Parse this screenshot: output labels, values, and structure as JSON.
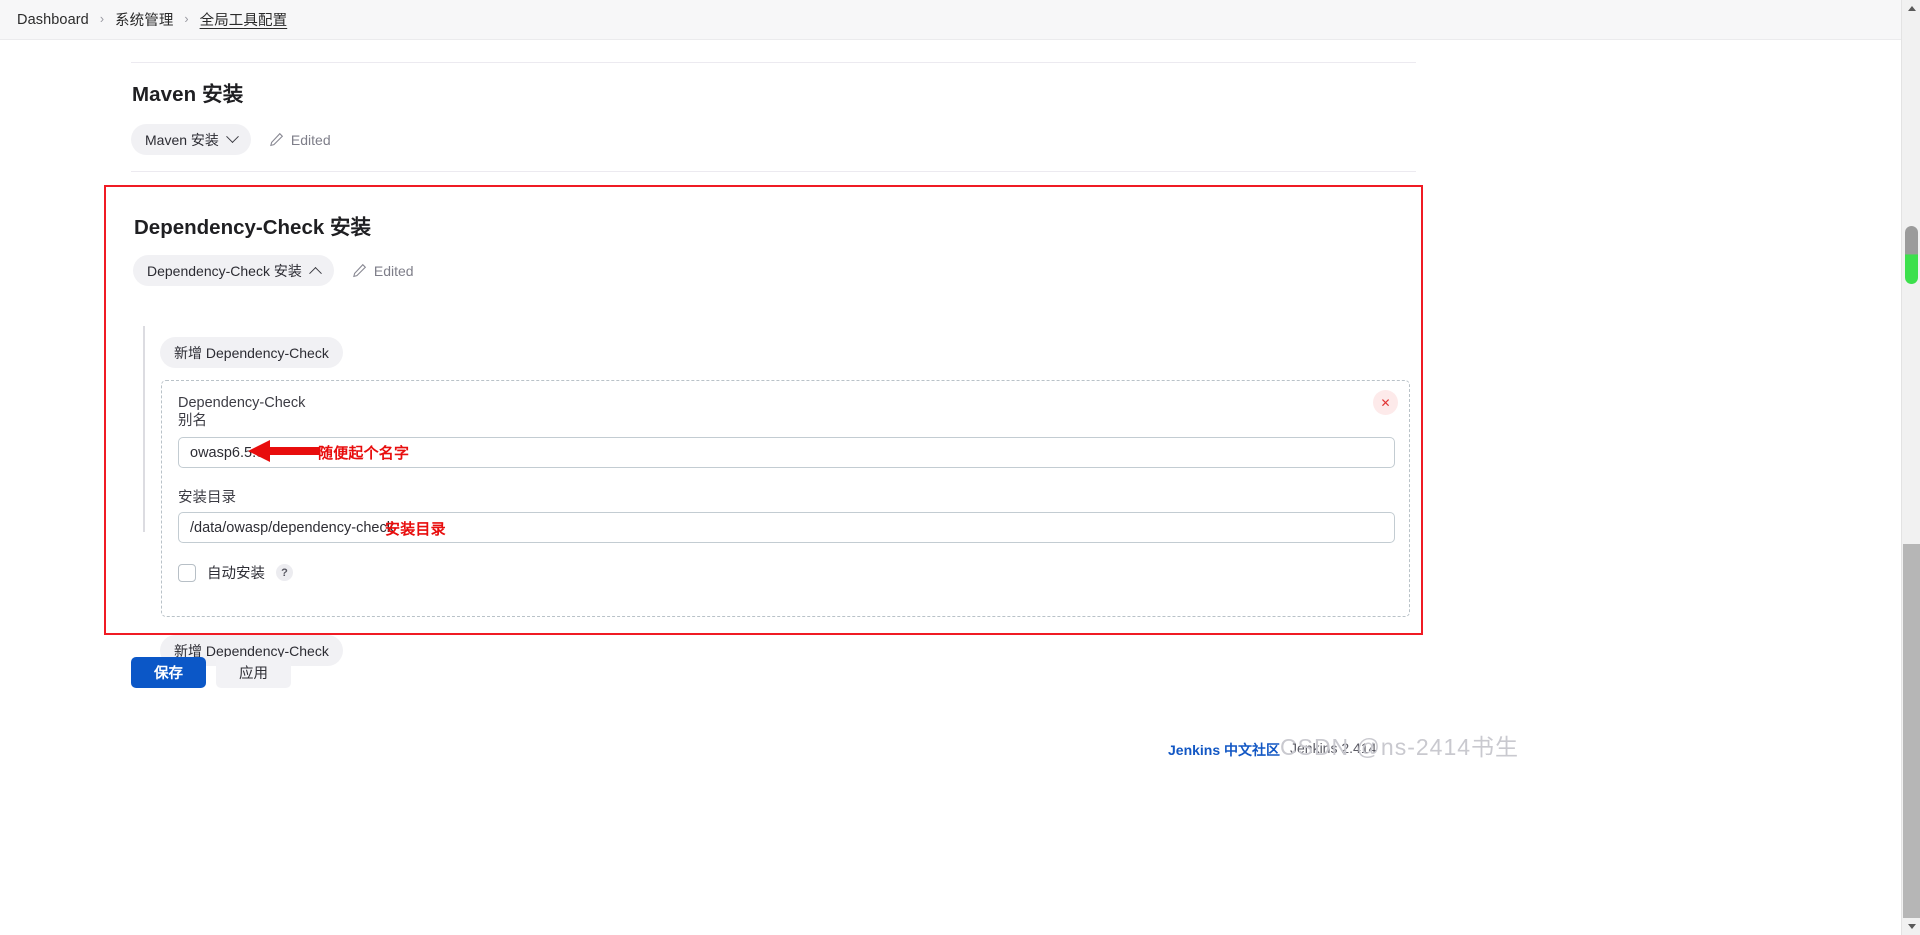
{
  "breadcrumb": {
    "items": [
      {
        "label": "Dashboard"
      },
      {
        "label": "系统管理"
      },
      {
        "label": "全局工具配置"
      }
    ],
    "separator": "›"
  },
  "maven_section": {
    "title": "Maven 安装",
    "pill_label": "Maven 安装",
    "edited_label": "Edited"
  },
  "dependency_check_section": {
    "title": "Dependency-Check 安装",
    "pill_label": "Dependency-Check 安装",
    "edited_label": "Edited",
    "add_button_top": "新增 Dependency-Check",
    "add_button_bottom": "新增 Dependency-Check",
    "entry": {
      "heading": "Dependency-Check",
      "alias_label": "别名",
      "alias_value": "owasp6.5.3",
      "alias_placeholder": "",
      "home_label": "安装目录",
      "home_value": "/data/owasp/dependency-check",
      "home_placeholder": "",
      "auto_install_label": "自动安装",
      "auto_install_checked": false,
      "help_badge": "?",
      "delete_icon": "✕"
    }
  },
  "annotations": [
    {
      "text": "随便起个名字"
    },
    {
      "text": "安装目录"
    }
  ],
  "actions": {
    "save_label": "保存",
    "apply_label": "应用"
  },
  "footer": {
    "community_link": "Jenkins 中文社区",
    "version": "Jenkins 2.414",
    "watermark": "CSDN @ns-2414书生"
  },
  "colors": {
    "accent_blue": "#0b57c7",
    "highlight_red": "#f01b24",
    "annotation_red": "#e80d0d",
    "scrollbar_green": "#3ce04c"
  }
}
